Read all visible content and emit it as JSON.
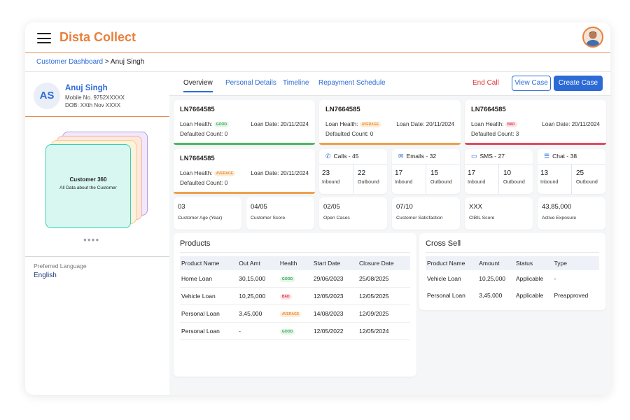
{
  "app": {
    "title": "Dista Collect"
  },
  "breadcrumb": {
    "link": "Customer Dashboard",
    "separator": ">",
    "current": "Anuj Singh"
  },
  "profile": {
    "initials": "AS",
    "name": "Anuj Singh",
    "mobile": "Mobile No. 9752XXXXX",
    "dob": "DOB: XXth Nov XXXX"
  },
  "carousel": {
    "title": "Customer 360",
    "subtitle": "All Data about the Customer",
    "dots": "●●●●"
  },
  "preferred_language": {
    "label": "Preferred Language",
    "value": "English"
  },
  "tabs": [
    {
      "label": "Overview"
    },
    {
      "label": "Personal Details"
    },
    {
      "label": "Timeline"
    },
    {
      "label": "Repayment Schedule"
    }
  ],
  "actions": {
    "end_call": "End Call",
    "view_case": "View Case",
    "create_case": "Create Case"
  },
  "loan_labels": {
    "health": "Loan Health:",
    "date": "Loan Date:",
    "defaulted": "Defaulted Count:"
  },
  "loans": [
    {
      "id": "LN7664585",
      "health": "GOOD",
      "date": "20/11/2024",
      "defaulted": "0",
      "color": "#4cb963"
    },
    {
      "id": "LN7664585",
      "health": "AVERAGE",
      "date": "20/11/2024",
      "defaulted": "0",
      "color": "#f0a04b"
    },
    {
      "id": "LN7664585",
      "health": "BAD",
      "date": "20/11/2024",
      "defaulted": "3",
      "color": "#e04a5f"
    },
    {
      "id": "LN7664585",
      "health": "AVERAGE",
      "date": "20/11/2024",
      "defaulted": "0",
      "color": "#f0a04b"
    }
  ],
  "comms": [
    {
      "title": "Calls - 45",
      "icon": "phone-icon",
      "inbound": "23",
      "outbound": "22"
    },
    {
      "title": "Emails - 32",
      "icon": "mail-icon",
      "inbound": "17",
      "outbound": "15"
    },
    {
      "title": "SMS - 27",
      "icon": "sms-icon",
      "inbound": "17",
      "outbound": "10"
    },
    {
      "title": "Chat - 38",
      "icon": "chat-icon",
      "inbound": "13",
      "outbound": "25"
    }
  ],
  "comm_labels": {
    "inbound": "Inbound",
    "outbound": "Outbound"
  },
  "metrics": [
    {
      "value": "03",
      "label": "Customer Age (Year)"
    },
    {
      "value": "04/05",
      "label": "Customer Score"
    },
    {
      "value": "02/05",
      "label": "Open Cases"
    },
    {
      "value": "07/10",
      "label": "Customer Satisfaction"
    },
    {
      "value": "XXX",
      "label": "CIBIL Score"
    },
    {
      "value": "43,85,000",
      "label": "Active Exposure"
    }
  ],
  "products": {
    "title": "Products",
    "headers": [
      "Product Name",
      "Out Amt",
      "Health",
      "Start Date",
      "Closure Date"
    ],
    "rows": [
      {
        "name": "Home Loan",
        "amt": "30,15,000",
        "health": "GOOD",
        "start": "29/06/2023",
        "close": "25/08/2025"
      },
      {
        "name": "Vehicle Loan",
        "amt": "10,25,000",
        "health": "BAD",
        "start": "12/05/2023",
        "close": "12/05/2025"
      },
      {
        "name": "Personal Loan",
        "amt": "3,45,000",
        "health": "AVERAGE",
        "start": "14/08/2023",
        "close": "12/09/2025"
      },
      {
        "name": "Personal Loan",
        "amt": "-",
        "health": "GOOD",
        "start": "12/05/2022",
        "close": "12/05/2024"
      }
    ]
  },
  "cross_sell": {
    "title": "Cross Sell",
    "headers": [
      "Product Name",
      "Amount",
      "Status",
      "Type"
    ],
    "rows": [
      {
        "name": "Vehicle Loan",
        "amount": "10,25,000",
        "status": "Applicable",
        "type": "-"
      },
      {
        "name": "Personal Loan",
        "amount": "3,45,000",
        "status": "Applicable",
        "type": "Preapproved"
      }
    ]
  }
}
